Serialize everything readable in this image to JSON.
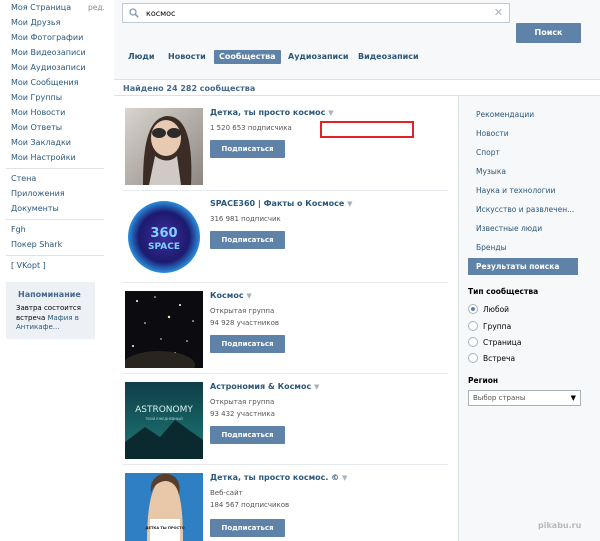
{
  "sidebar": {
    "items": [
      {
        "label": "Моя Страница"
      },
      {
        "label": "Мои Друзья"
      },
      {
        "label": "Мои Фотографии"
      },
      {
        "label": "Мои Видеозаписи"
      },
      {
        "label": "Мои Аудиозаписи"
      },
      {
        "label": "Мои Сообщения"
      },
      {
        "label": "Мои Группы"
      },
      {
        "label": "Мои Новости"
      },
      {
        "label": "Мои Ответы"
      },
      {
        "label": "Мои Закладки"
      },
      {
        "label": "Мои Настройки"
      }
    ],
    "edit_label": "ред.",
    "apps": [
      {
        "label": "Стена"
      },
      {
        "label": "Приложения"
      },
      {
        "label": "Документы"
      }
    ],
    "extra": [
      {
        "label": "Fgh"
      },
      {
        "label": "Покер Shark"
      }
    ],
    "vkopt": "[ VKopt ]",
    "reminder": {
      "title": "Напоминание",
      "text_before": "Завтра состоится встреча ",
      "link": "Мафия в Антикафе..."
    }
  },
  "search": {
    "query": "космос",
    "button": "Поиск",
    "tabs": [
      {
        "label": "Люди"
      },
      {
        "label": "Новости"
      },
      {
        "label": "Сообщества"
      },
      {
        "label": "Аудиозаписи"
      },
      {
        "label": "Видеозаписи"
      }
    ],
    "found": "Найдено 24 282 сообщества"
  },
  "results": [
    {
      "name": "Детка, ты просто космос",
      "line1": "1 520 653 подписчика",
      "line2": "",
      "button": "Подписаться"
    },
    {
      "name": "SPACE360 | Факты о Космосе",
      "line1": "316 981 подписчик",
      "line2": "",
      "button": "Подписаться"
    },
    {
      "name": "Космос",
      "line1": "Открытая группа",
      "line2": "94 928 участников",
      "button": "Подписаться"
    },
    {
      "name": "Астрономия & Космос",
      "line1": "Открытая группа",
      "line2": "93 432 участника",
      "button": "Подписаться"
    },
    {
      "name": "Детка, ты просто космос. ©",
      "line1": "Веб-сайт",
      "line2": "184 567 подписчиков",
      "button": "Подписаться"
    }
  ],
  "thumbs": {
    "space360_text": "360 SPACE",
    "astronomy_text": "ASTRONOMY",
    "astronomy_sub": "ТВОЙ ЕЖЕДНЕВНЫЙ",
    "girl_shirt": "ДЕТКА ТЫ ПРОСТО"
  },
  "filters": {
    "categories": [
      {
        "label": "Рекомендации"
      },
      {
        "label": "Новости"
      },
      {
        "label": "Спорт"
      },
      {
        "label": "Музыка"
      },
      {
        "label": "Наука и технологии"
      },
      {
        "label": "Искусство и развлечен..."
      },
      {
        "label": "Известные люди"
      },
      {
        "label": "Бренды"
      }
    ],
    "active": "Результаты поиска",
    "type_title": "Тип сообщества",
    "types": [
      {
        "label": "Любой",
        "selected": true
      },
      {
        "label": "Группа",
        "selected": false
      },
      {
        "label": "Страница",
        "selected": false
      },
      {
        "label": "Встреча",
        "selected": false
      }
    ],
    "region_title": "Регион",
    "region_value": "Выбор страны"
  },
  "watermark": "pikabu.ru",
  "colors": {
    "accent": "#5e82a8",
    "link": "#2b587a",
    "highlight": "#e4212b"
  }
}
